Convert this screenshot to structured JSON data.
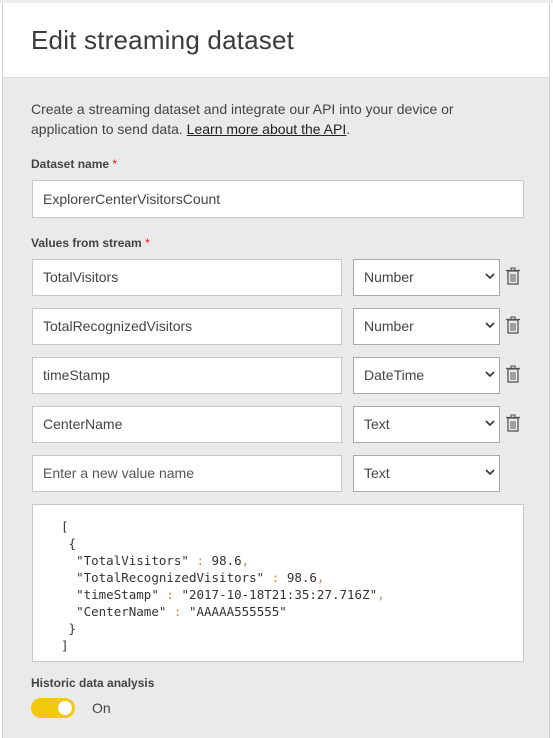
{
  "header": {
    "title": "Edit streaming dataset"
  },
  "description": {
    "text": "Create a streaming dataset and integrate our API into your device or application to send data.",
    "link": "Learn more about the API",
    "trailing": "."
  },
  "dataset_name": {
    "label": "Dataset name",
    "required_mark": "*",
    "value": "ExplorerCenterVisitorsCount"
  },
  "values": {
    "label": "Values from stream",
    "required_mark": "*",
    "rows": [
      {
        "name": "TotalVisitors",
        "type": "Number"
      },
      {
        "name": "TotalRecognizedVisitors",
        "type": "Number"
      },
      {
        "name": "timeStamp",
        "type": "DateTime"
      },
      {
        "name": "CenterName",
        "type": "Text"
      }
    ],
    "new_row": {
      "placeholder": "Enter a new value name",
      "type": "Text"
    }
  },
  "sample_json": {
    "open_bracket": "[",
    "open_brace": "{",
    "close_brace": "}",
    "close_bracket": "]",
    "lines": [
      {
        "key": "\"TotalVisitors\"",
        "value": "98.6"
      },
      {
        "key": "\"TotalRecognizedVisitors\"",
        "value": "98.6"
      },
      {
        "key": "\"timeStamp\"",
        "value": "\"2017-10-18T21:35:27.716Z\""
      },
      {
        "key": "\"CenterName\"",
        "value": "\"AAAAA555555\""
      }
    ]
  },
  "historic": {
    "label": "Historic data analysis",
    "toggle_state": "On",
    "enabled": true,
    "toggle_color": "#f2c811"
  },
  "icons": {
    "delete": "trash-icon",
    "dropdown": "chevron-down-icon"
  }
}
